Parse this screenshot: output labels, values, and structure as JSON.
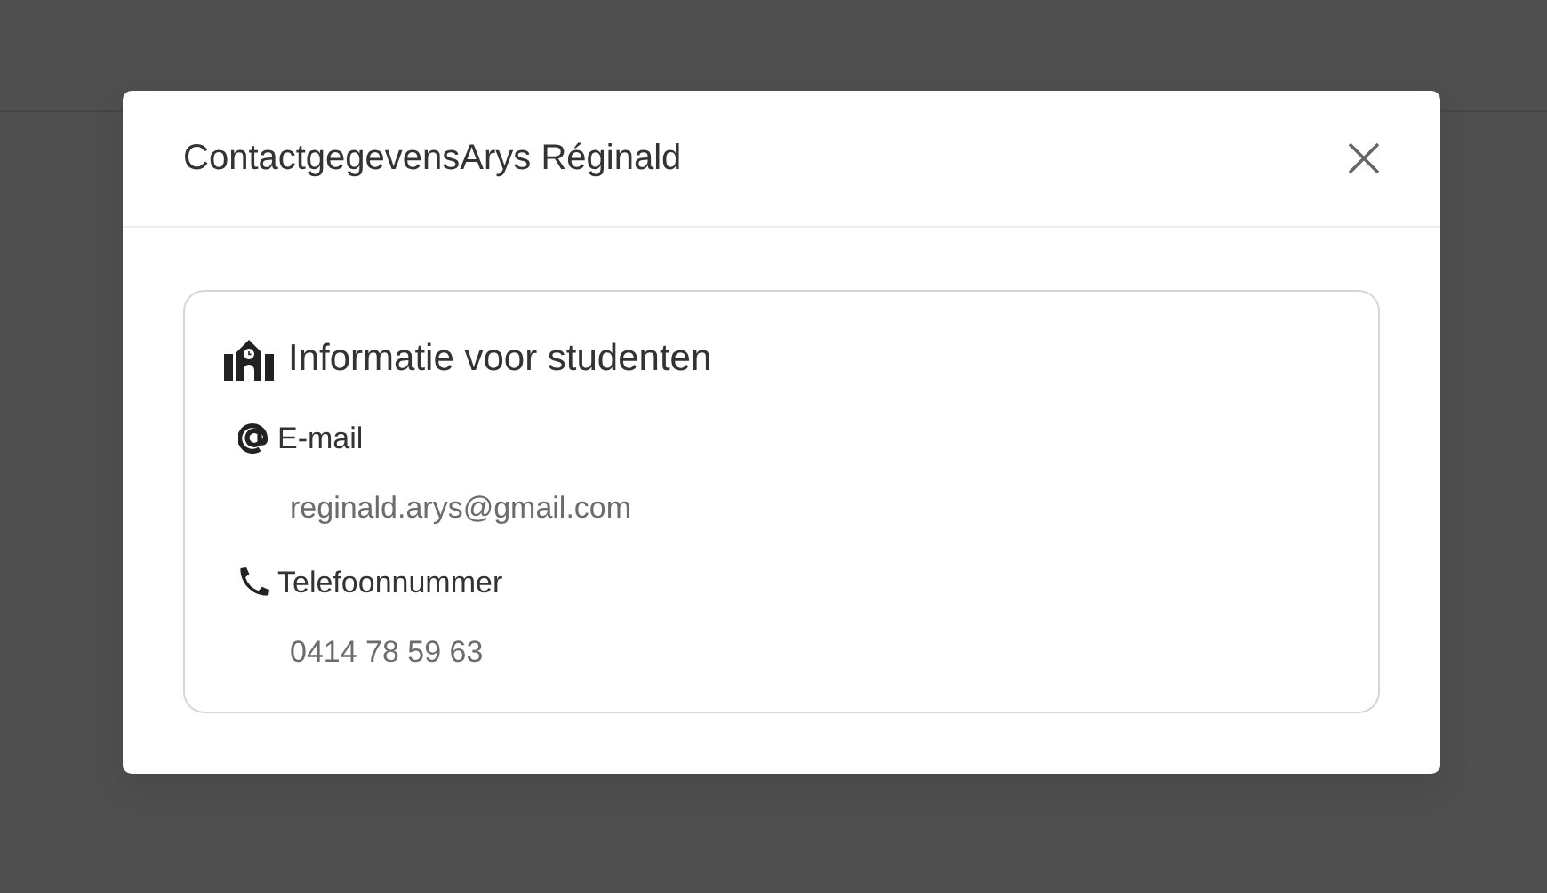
{
  "dialog": {
    "title": "ContactgegevensArys Réginald"
  },
  "section": {
    "title": "Informatie voor studenten",
    "fields": [
      {
        "kind": "email",
        "label": "E-mail",
        "value": "reginald.arys@gmail.com"
      },
      {
        "kind": "phone",
        "label": "Telefoonnummer",
        "value": "0414 78 59 63"
      }
    ]
  }
}
